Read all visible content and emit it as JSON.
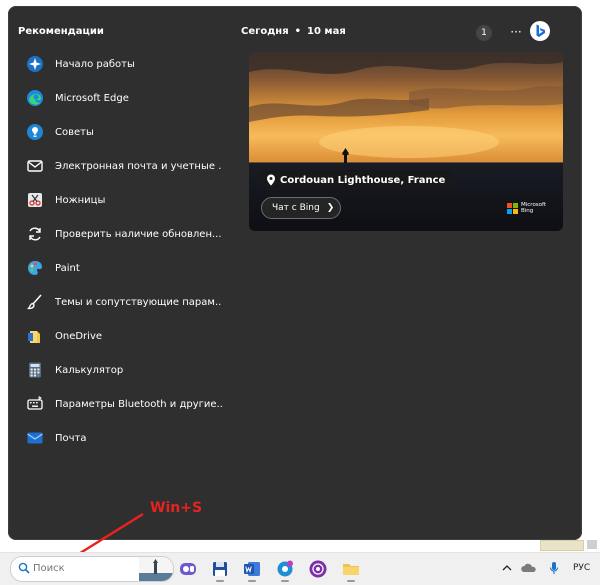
{
  "recommendations": {
    "title": "Рекомендации",
    "items": [
      {
        "label": "Начало работы",
        "icon": "get-started-icon"
      },
      {
        "label": "Microsoft Edge",
        "icon": "edge-icon"
      },
      {
        "label": "Советы",
        "icon": "tips-icon"
      },
      {
        "label": "Электронная почта и учетные ...",
        "icon": "mail-accounts-icon"
      },
      {
        "label": "Ножницы",
        "icon": "snipping-tool-icon"
      },
      {
        "label": "Проверить наличие обновлен...",
        "icon": "update-icon"
      },
      {
        "label": "Paint",
        "icon": "paint-icon"
      },
      {
        "label": "Темы и сопутствующие парам...",
        "icon": "themes-brush-icon"
      },
      {
        "label": "OneDrive",
        "icon": "onedrive-icon"
      },
      {
        "label": "Калькулятор",
        "icon": "calculator-icon"
      },
      {
        "label": "Параметры Bluetooth и другие...",
        "icon": "bluetooth-settings-icon"
      },
      {
        "label": "Почта",
        "icon": "mail-icon"
      }
    ]
  },
  "news": {
    "today": "Сегодня",
    "separator": "•",
    "date": "10 мая",
    "badge_count": "1",
    "more_label": "···",
    "card": {
      "place": "Cordouan Lighthouse, France",
      "chat_button": "Чат с Bing",
      "brand_line1": "Microsoft",
      "brand_line2": "Bing"
    }
  },
  "annotation": {
    "hint": "Win+S",
    "color": "#e8231f"
  },
  "taskbar": {
    "search_placeholder": "Поиск",
    "language": "РУС"
  },
  "colors": {
    "panel_bg": "#2f2f2f",
    "taskbar_bg": "#f0f0f0"
  }
}
